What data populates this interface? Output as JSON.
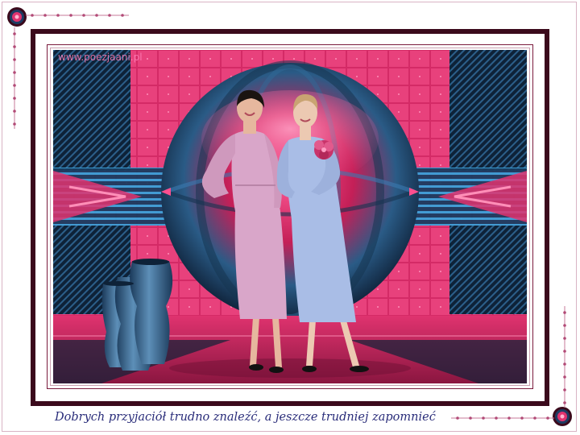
{
  "watermark": "www.poezjaani.pl",
  "caption": "Dobrych przyjaciół trudno znaleźć, a jeszcze trudniej zapomnieć",
  "colors": {
    "frame_dark": "#3b0a1c",
    "pink": "#e0336f",
    "hot_pink": "#ff4f8f",
    "teal": "#2c5f8a",
    "navy": "#0e2238",
    "caption_text": "#2a2d7a",
    "dress_left": "#d9a6c9",
    "dress_right": "#a9bde6"
  },
  "icons": [
    "corner-medallion-icon",
    "ornament-chain-icon",
    "vase-icon",
    "flower-brooch-icon"
  ]
}
